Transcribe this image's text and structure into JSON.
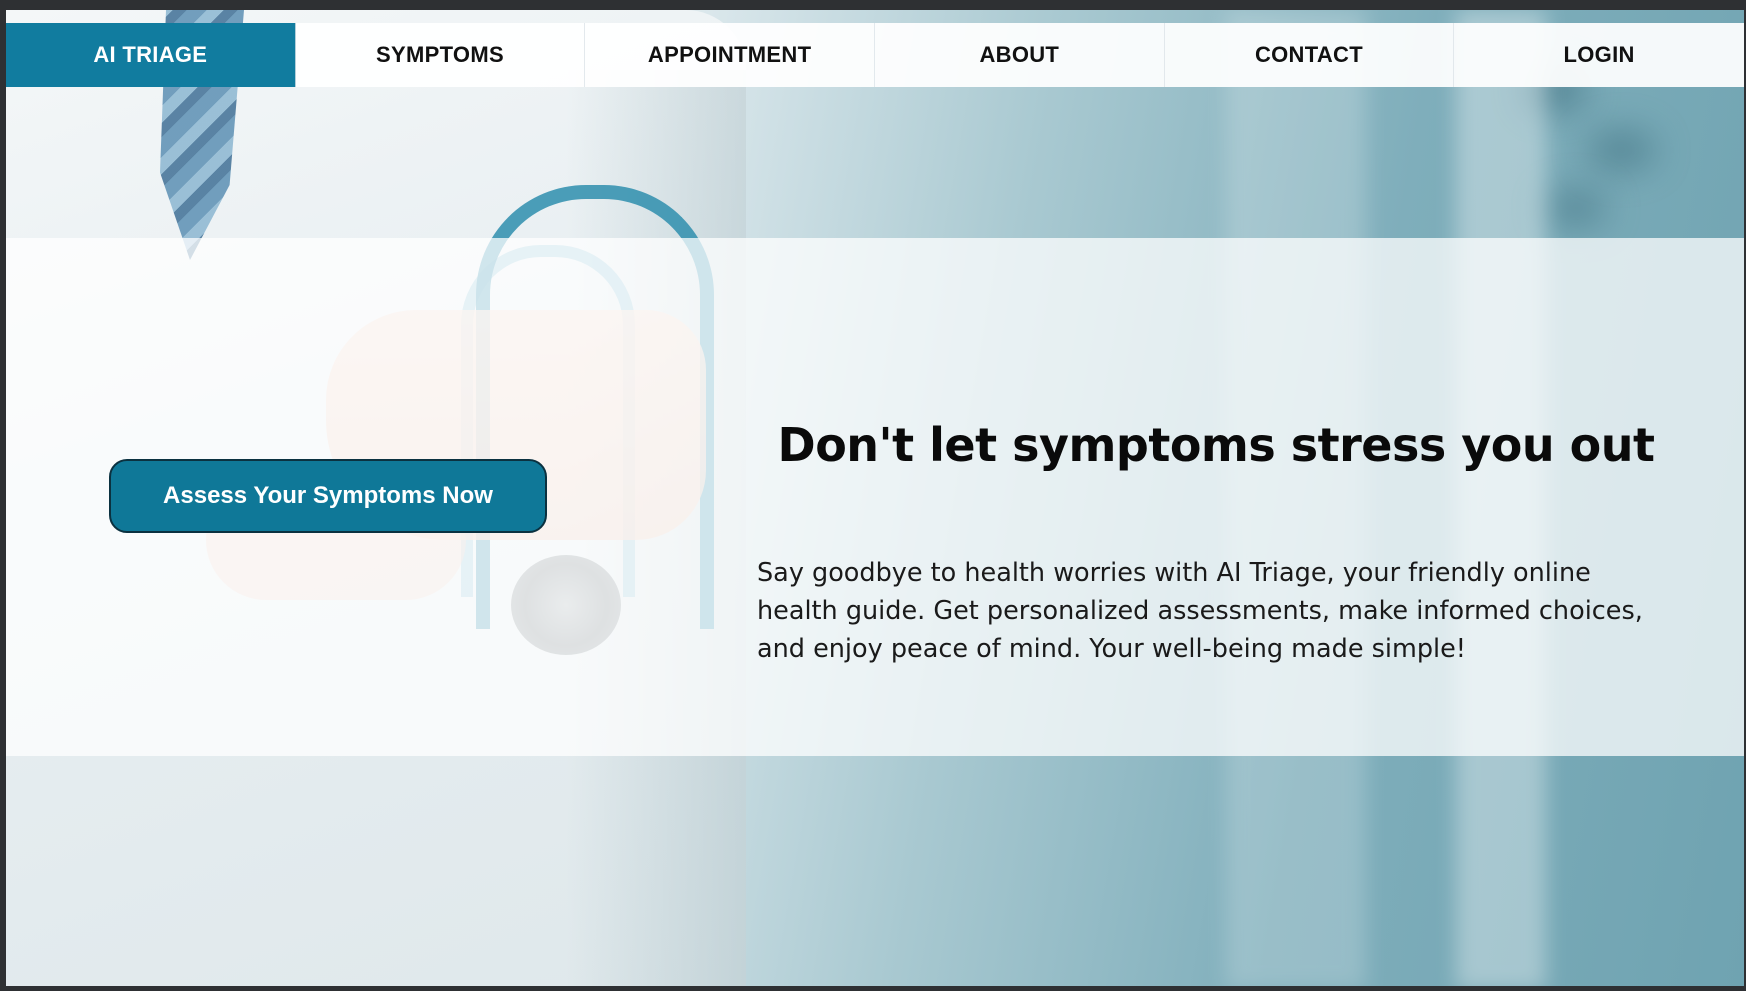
{
  "nav": {
    "items": [
      {
        "label": "AI TRIAGE",
        "active": true
      },
      {
        "label": "SYMPTOMS",
        "active": false
      },
      {
        "label": "APPOINTMENT",
        "active": false
      },
      {
        "label": "ABOUT",
        "active": false
      },
      {
        "label": "CONTACT",
        "active": false
      },
      {
        "label": "LOGIN",
        "active": false
      }
    ],
    "accent_color": "#117c9f"
  },
  "hero": {
    "cta_label": "Assess Your Symptoms Now",
    "headline": "Don't let symptoms stress you out",
    "body": "Say goodbye to health worries with AI Triage, your friendly online health guide. Get personalized assessments, make informed choices, and enjoy peace of mind. Your well-being made simple!"
  },
  "background": {
    "image": "doctor-with-stethoscope-photo"
  }
}
